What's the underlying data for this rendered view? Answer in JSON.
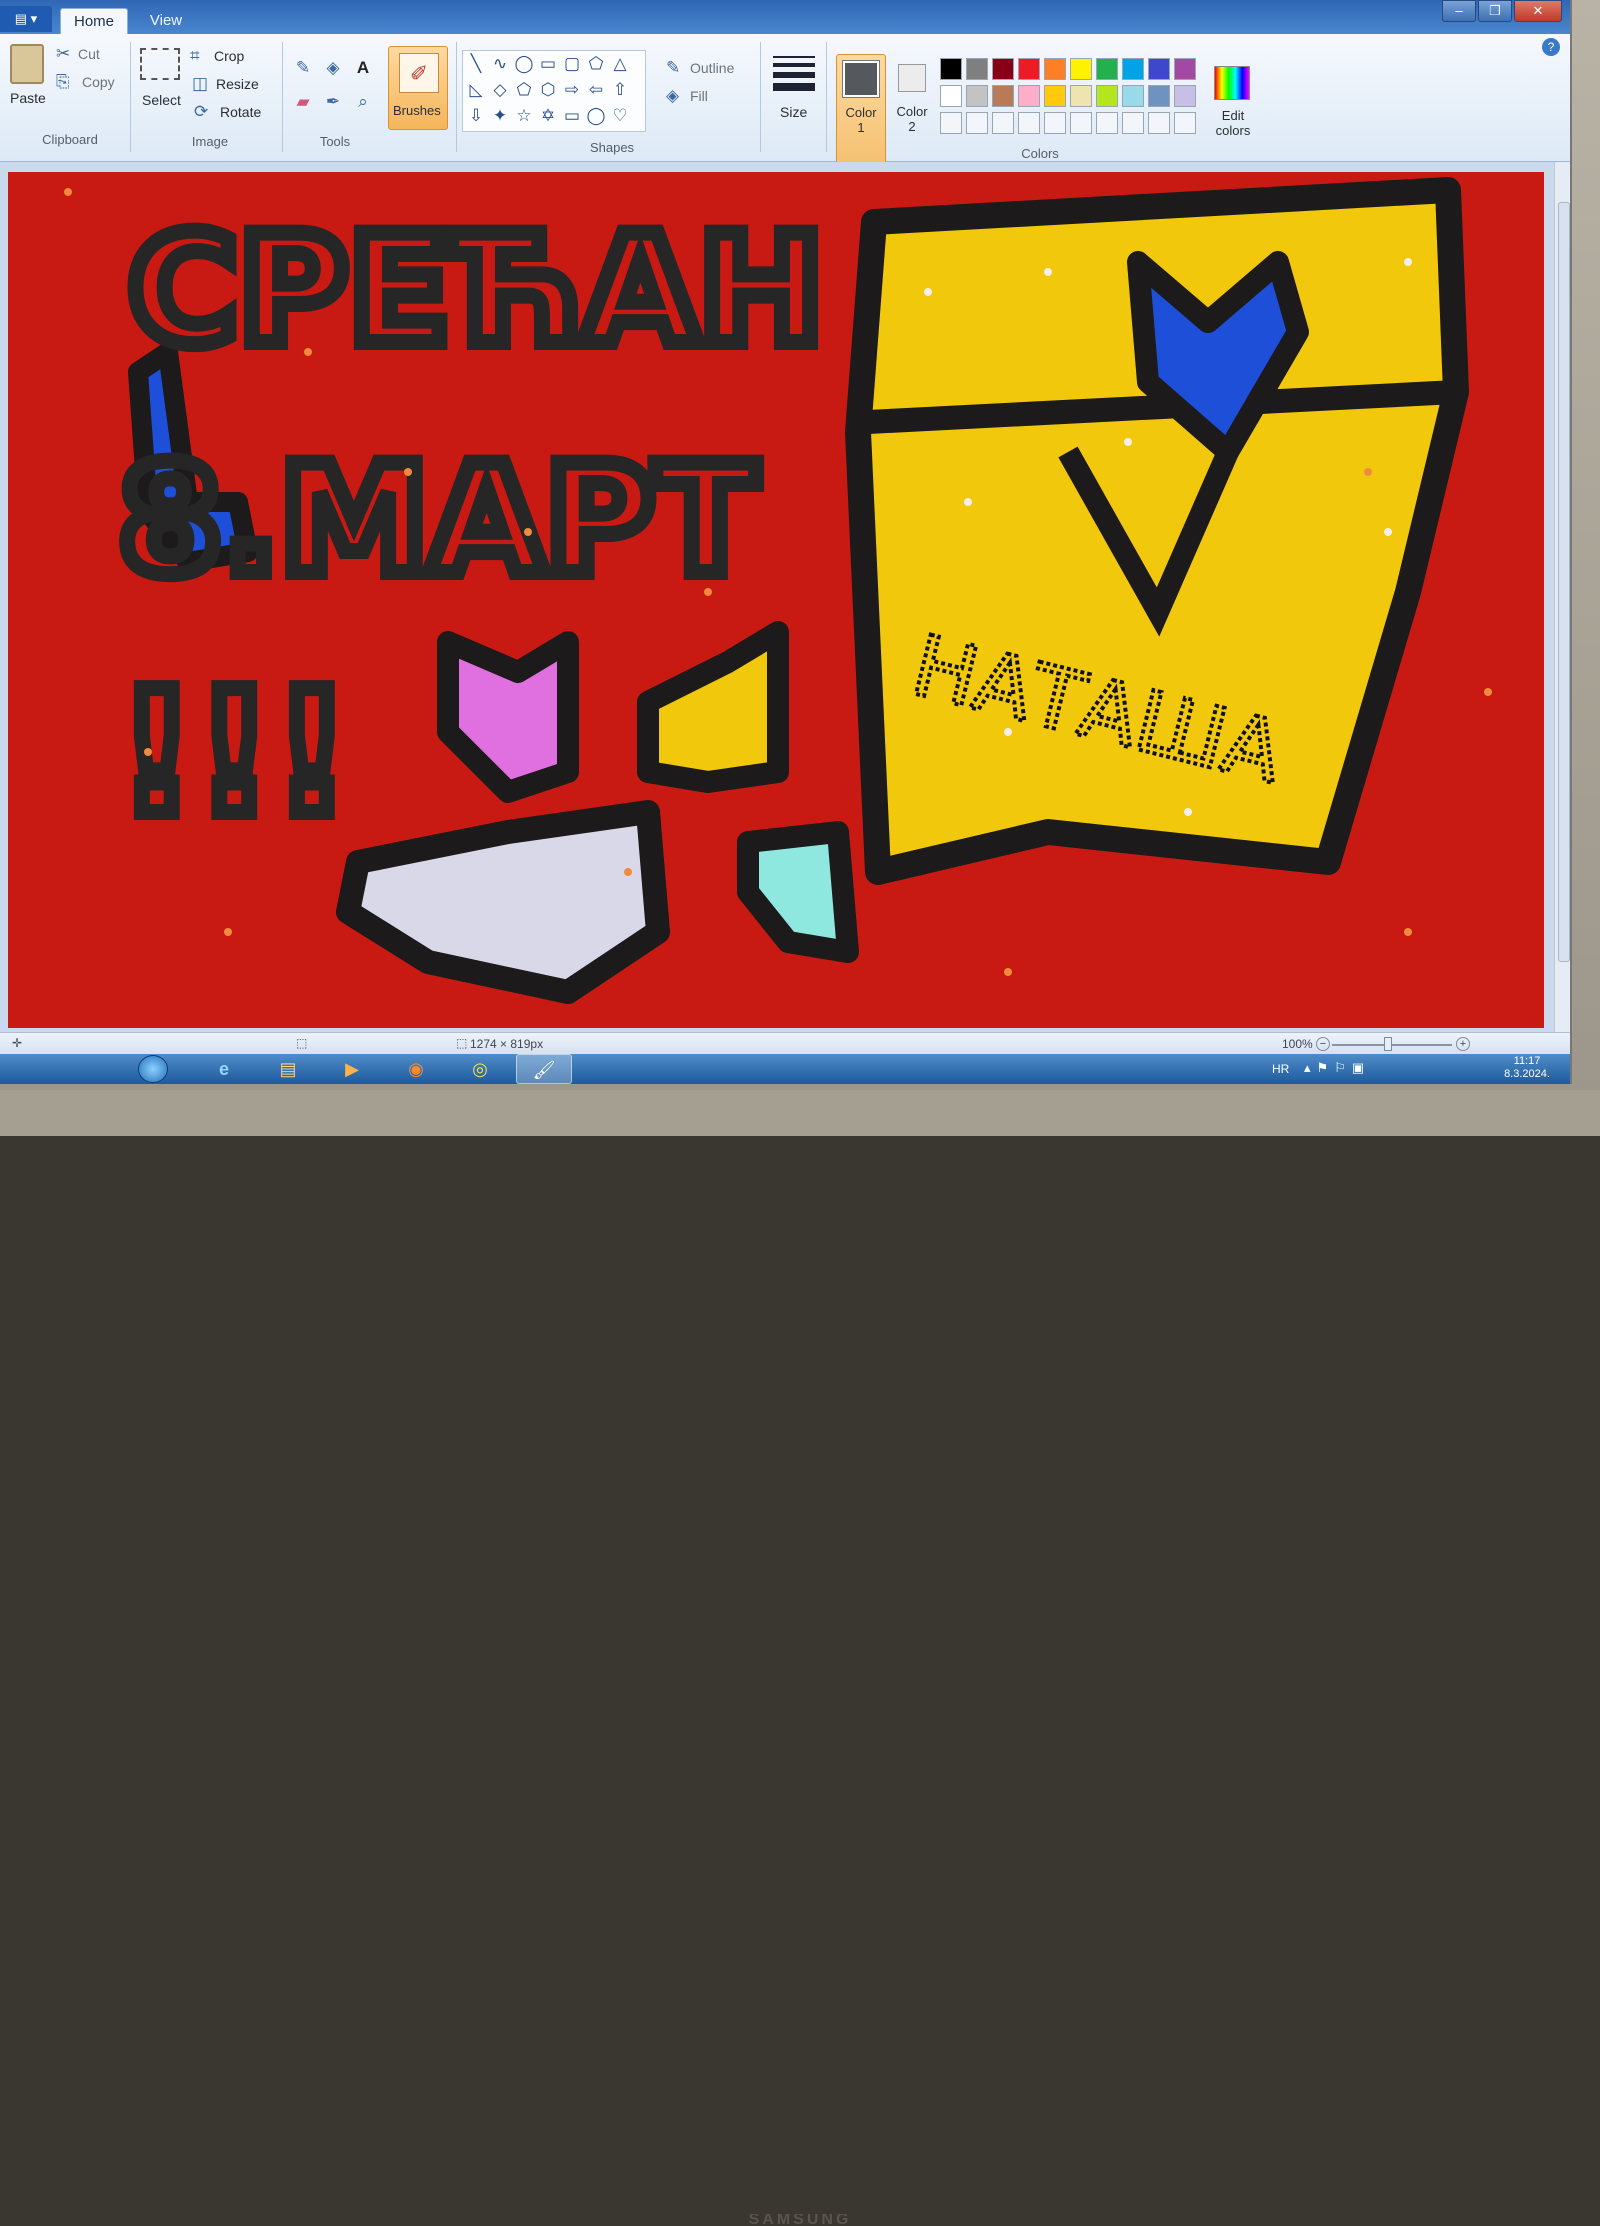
{
  "window": {
    "menu_label": "▤ ▾",
    "minimize": "–",
    "maximize": "❐",
    "close": "✕",
    "help": "?"
  },
  "tabs": [
    {
      "label": "Home"
    },
    {
      "label": "View"
    }
  ],
  "ribbon": {
    "clipboard": {
      "paste": "Paste",
      "cut": "Cut",
      "copy": "Copy",
      "label": "Clipboard"
    },
    "image": {
      "select": "Select",
      "crop": "Crop",
      "resize": "Resize",
      "rotate": "Rotate",
      "label": "Image"
    },
    "tools": {
      "label": "Tools",
      "text_tool": "A"
    },
    "brushes": {
      "label": "Brushes"
    },
    "shapes": {
      "outline": "Outline",
      "fill": "Fill",
      "label": "Shapes"
    },
    "size": {
      "label": "Size"
    },
    "colors": {
      "color1": "Color 1",
      "color2": "Color 2",
      "edit": "Edit colors",
      "label": "Colors",
      "color1_value": "#55585c",
      "color2_value": "#ececec",
      "palette_row1": [
        "#000000",
        "#7f7f7f",
        "#880015",
        "#ed1c24",
        "#ff7f27",
        "#fff200",
        "#22b14c",
        "#00a2e8",
        "#3f48cc",
        "#a349a4"
      ],
      "palette_row2": [
        "#ffffff",
        "#c3c3c3",
        "#b97a57",
        "#ffaec9",
        "#ffc90e",
        "#efe4b0",
        "#b5e61d",
        "#99d9ea",
        "#7092be",
        "#c8bfe7"
      ]
    }
  },
  "canvas": {
    "background": "#c81a12",
    "line1": "СРЕЋАН",
    "line2": "8.МАРТ",
    "exclaim": "!!!",
    "signature": "НАТАША"
  },
  "status": {
    "dimensions": "1274 × 819px",
    "zoom": "100%"
  },
  "taskbar": {
    "language": "HR",
    "time": "11:17",
    "date": "8.3.2024."
  },
  "monitor_brand": "SAMSUNG"
}
